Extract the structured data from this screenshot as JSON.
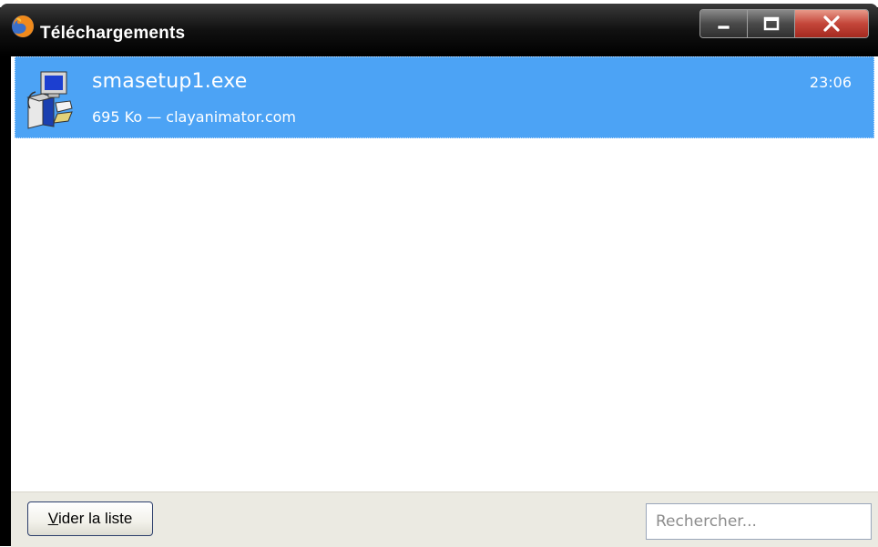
{
  "window": {
    "title": "Téléchargements",
    "icon": "firefox-icon",
    "controls": [
      "minimize-icon",
      "maximize-icon",
      "close-icon"
    ]
  },
  "downloads": [
    {
      "name": "smasetup1.exe",
      "size": "695 Ko",
      "separator": "—",
      "source": "clayanimator.com",
      "meta": "695 Ko — clayanimator.com",
      "time": "23:06",
      "icon": "installer-icon",
      "selected": true
    }
  ],
  "bottom": {
    "clear_label_first": "V",
    "clear_label_rest": "ider la liste",
    "search_placeholder": "Rechercher..."
  },
  "colors": {
    "selection": "#4ca3f5",
    "titlebar": "#000000",
    "close_button": "#c4463a"
  }
}
